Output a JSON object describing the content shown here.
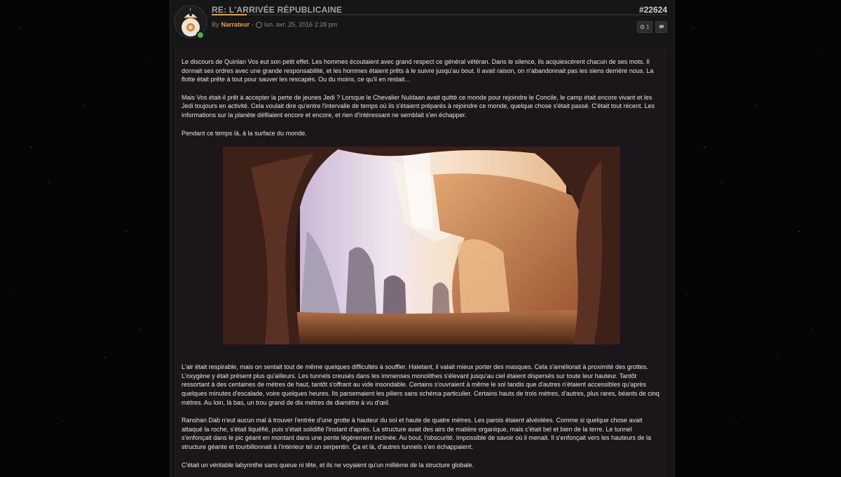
{
  "post": {
    "title": "RE: L'ARRIVÉE RÉPUBLICAINE",
    "number": "#22624",
    "by_label": "By",
    "author": "Narrateur",
    "separator": "-",
    "date": "lun. avr. 25, 2016 2:28 pm",
    "settings_count": "1",
    "accent_color": "#e8a21d",
    "online_color": "#4caf50"
  },
  "icons": {
    "clock": "clock-icon",
    "settings": "gear-icon",
    "quote": "comment-icon",
    "avatar": "bb8-avatar"
  },
  "content": {
    "paragraphs_before": [
      "Le discours de Quinlan Vos eut son petit effet. Les hommes écoutaient avec grand respect ce général vétéran. Dans le silence, ils acquiescèrent chacun de ses mots. Il donnait ses ordres avec une grande responsabilité, et les hommes étaient prêts à le suivre jusqu'au bout. Il avait raison, on n'abandonnait pas les siens derrière nous. La flotte était prête à tout pour sauver les rescapés. Ou du moins, ce qu'il en restait...",
      "Mais Vos était-il prêt à accepter la perte de jeunes Jedi ? Lorsque le Chevalier Nuldaan avait quitté ce monde pour rejoindre le Concile, le camp était encore vivant et les Jedi toujours en activité. Cela voulait dire qu'entre l'intervalle de temps où ils s'étaient préparés à rejoindre ce monde, quelque chose s'était passé. C'était tout récent. Les informations sur la planète défilaient encore et encore, et rien d'intéressant ne semblait s'en échapper.",
      "Pendant ce temps là, à la surface du monde."
    ],
    "paragraphs_after": [
      "L'air était respirable, mais on sentait tout de même quelques difficultés à souffler. Haletant, il valait mieux porter des masques. Cela s'améliorait à proximité des grottes. L'oxygène y était présent plus qu'ailleurs. Les tunnels creusés dans les immenses monolithes s'élevant jusqu'au ciel étaient dispersés sur toute leur hauteur. Tantôt ressortant à des centaines de mètres de haut, tantôt s'offrant au vide insondable. Certains s'ouvraient à même le sol tandis que d'autres n'étaient accessibles qu'après quelques minutes d'escalade, voire quelques heures. Ils parsemaient les piliers sans schéma particulier. Certains hauts de trois mètres, d'autres, plus rares, béants de cinq mètres. Au loin, là bas, un trou grand de dix mètres de diamètre à vu d'œil.",
      "Ranshan Dab n'eut aucun mal à trouver l'entrée d'une grotte à hauteur du sol et haute de quatre mètres. Les parois étaient alvéolées. Comme si quelque chose avait attaqué la roche, s'était liquéfié, puis s'était solidifié l'instant d'après. La structure avait des airs de matière organique, mais c'était bel et bien de la terre. Le tunnel s'enfonçait dans le pic géant en montant dans une pente légèrement inclinée. Au bout, l'obscurité. Impossible de savoir où il menait. Il s'enfonçait vers les hauteurs de la structure géante et tourbillonnait à l'intérieur tel un serpentin. Ça et là, d'autres tunnels s'en échappaient.",
      "C'était un véritable labyrinthe sans queue ni tête, et ils ne voyaient qu'un millième de la structure globale."
    ]
  }
}
